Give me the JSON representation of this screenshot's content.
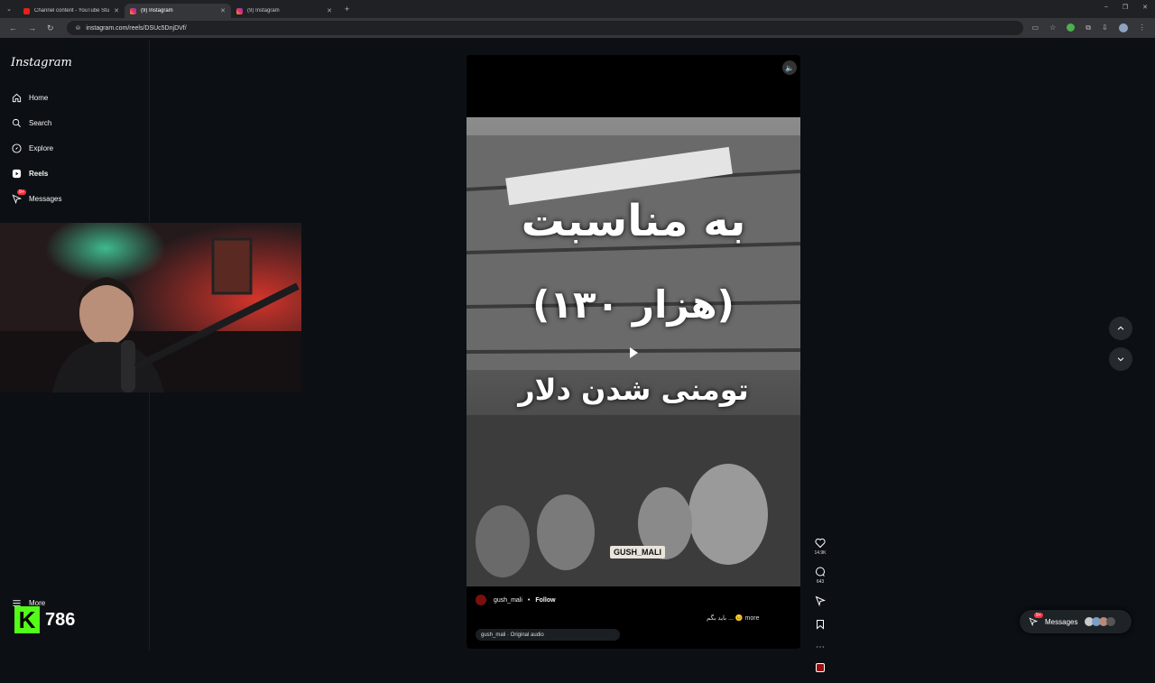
{
  "browser": {
    "tabs": [
      {
        "title": "Channel content - YouTube Stu",
        "kind": "yt",
        "active": false
      },
      {
        "title": "(9) Instagram",
        "kind": "ig",
        "active": true
      },
      {
        "title": "(9) Instagram",
        "kind": "ig",
        "active": false
      }
    ],
    "url": "instagram.com/reels/DSUc5DnjDVf/"
  },
  "sidebar": {
    "logo": "Instagram",
    "items": [
      {
        "label": "Home",
        "icon": "home-icon"
      },
      {
        "label": "Search",
        "icon": "search-icon"
      },
      {
        "label": "Explore",
        "icon": "compass-icon"
      },
      {
        "label": "Reels",
        "icon": "reels-icon"
      },
      {
        "label": "Messages",
        "icon": "messenger-icon",
        "badge": "9+"
      },
      {
        "label": "More",
        "icon": "menu-icon"
      }
    ]
  },
  "overlay": {
    "brand_number": "786"
  },
  "reel": {
    "caption_line1": "به مناسبت",
    "caption_line2": "(۱۳۰ هزار)",
    "caption_line3": "تومنی شدن دلار",
    "watermark": "GUSH_MALI",
    "username": "gush_mali",
    "separator": "•",
    "follow_label": "Follow",
    "description": "باید بگم ... 😐 more",
    "audio": "gush_mali · Original audio"
  },
  "actions": {
    "likes": "14.9K",
    "comments": "643"
  },
  "messages_pill": {
    "label": "Messages",
    "badge": "9+"
  }
}
